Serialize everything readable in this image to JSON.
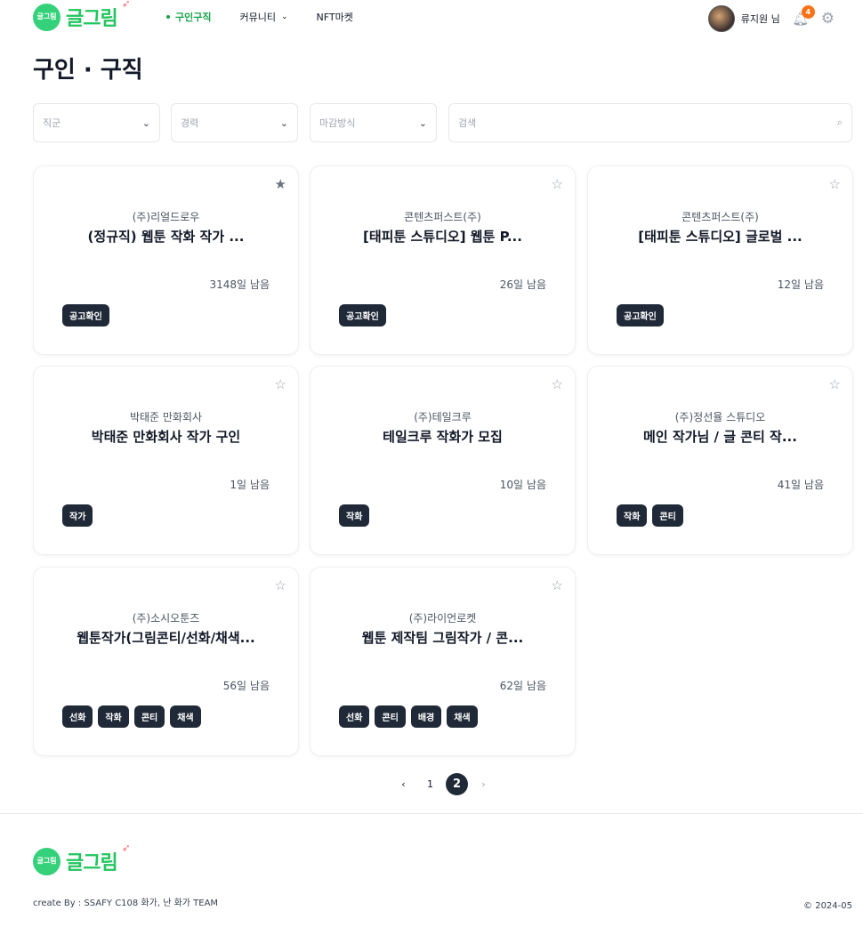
{
  "header": {
    "logo_mark": "글그림",
    "logo_text": "글그림",
    "nav": [
      {
        "label": "구인구직",
        "active": true
      },
      {
        "label": "커뮤니티",
        "dropdown": true
      },
      {
        "label": "NFT마켓"
      }
    ],
    "user_name": "류지원 님",
    "notification_count": "4"
  },
  "page_title": "구인 · 구직",
  "filters": {
    "job_type": "직군",
    "career": "경력",
    "deadline": "마감방식",
    "search_placeholder": "검색"
  },
  "cards": [
    {
      "company": "(주)리얼드로우",
      "title": "(정규직) 웹툰 작화 작가 ...",
      "days": "3148일 남음",
      "tags": [
        "공고확인"
      ],
      "starred": true
    },
    {
      "company": "콘텐츠퍼스트(주)",
      "title": "[태피툰 스튜디오] 웹툰 P...",
      "days": "26일 남음",
      "tags": [
        "공고확인"
      ],
      "starred": false
    },
    {
      "company": "콘텐츠퍼스트(주)",
      "title": "[태피툰 스튜디오] 글로벌 ...",
      "days": "12일 남음",
      "tags": [
        "공고확인"
      ],
      "starred": false
    },
    {
      "company": "박태준 만화회사",
      "title": "박태준 만화회사 작가 구인",
      "days": "1일 남음",
      "tags": [
        "작가"
      ],
      "starred": false
    },
    {
      "company": "(주)테일크루",
      "title": "테일크루 작화가 모집",
      "days": "10일 남음",
      "tags": [
        "작화"
      ],
      "starred": false
    },
    {
      "company": "(주)정선율 스튜디오",
      "title": "메인 작가님 / 글 콘티 작...",
      "days": "41일 남음",
      "tags": [
        "작화",
        "콘티"
      ],
      "starred": false
    },
    {
      "company": "(주)소시오툰즈",
      "title": "웹툰작가(그림콘티/선화/채색...",
      "days": "56일 남음",
      "tags": [
        "선화",
        "작화",
        "콘티",
        "채색"
      ],
      "starred": false
    },
    {
      "company": "(주)라이언로켓",
      "title": "웹툰 제작팀 그림작가 / 콘...",
      "days": "62일 남음",
      "tags": [
        "선화",
        "콘티",
        "배경",
        "채색"
      ],
      "starred": false
    }
  ],
  "pagination": {
    "prev": "‹",
    "pages": [
      "1",
      "2"
    ],
    "current": "2",
    "next": "›"
  },
  "footer": {
    "logo_text": "글그림",
    "credit": "create By : SSAFY C108 화가, 난 화가 TEAM",
    "copyright": "© 2024-05"
  },
  "colors": {
    "brand_green": "#22c55e",
    "tag_dark": "#1f2937",
    "badge_orange": "#f97316"
  }
}
